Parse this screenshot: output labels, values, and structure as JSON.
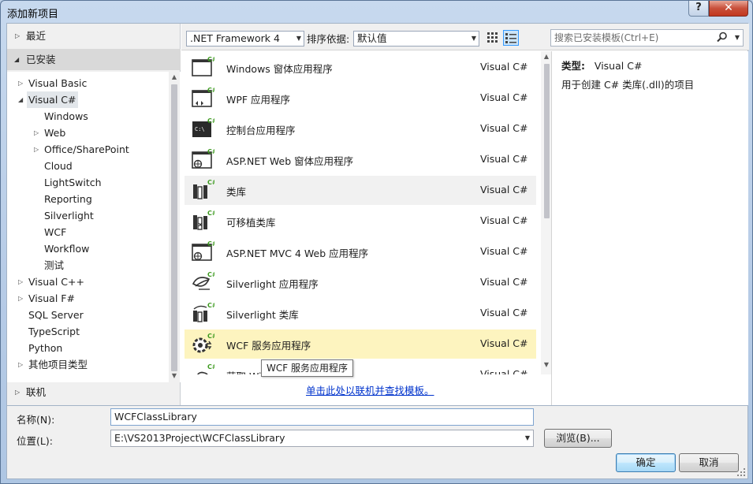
{
  "window": {
    "title": "添加新项目"
  },
  "titlebar": {
    "help_glyph": "?",
    "close_glyph": "✕"
  },
  "left_panel": {
    "recent": "最近",
    "installed": "已安装",
    "online": "联机",
    "tree": [
      {
        "label": "Visual Basic",
        "level": 0,
        "arrow": "collapsed"
      },
      {
        "label": "Visual C#",
        "level": 0,
        "arrow": "expanded",
        "selected": true
      },
      {
        "label": "Windows",
        "level": 1,
        "arrow": "none"
      },
      {
        "label": "Web",
        "level": 1,
        "arrow": "collapsed"
      },
      {
        "label": "Office/SharePoint",
        "level": 1,
        "arrow": "collapsed"
      },
      {
        "label": "Cloud",
        "level": 1,
        "arrow": "none"
      },
      {
        "label": "LightSwitch",
        "level": 1,
        "arrow": "none"
      },
      {
        "label": "Reporting",
        "level": 1,
        "arrow": "none"
      },
      {
        "label": "Silverlight",
        "level": 1,
        "arrow": "none"
      },
      {
        "label": "WCF",
        "level": 1,
        "arrow": "none"
      },
      {
        "label": "Workflow",
        "level": 1,
        "arrow": "none"
      },
      {
        "label": "测试",
        "level": 1,
        "arrow": "none"
      },
      {
        "label": "Visual C++",
        "level": 0,
        "arrow": "collapsed"
      },
      {
        "label": "Visual F#",
        "level": 0,
        "arrow": "collapsed"
      },
      {
        "label": "SQL Server",
        "level": 0,
        "arrow": "none"
      },
      {
        "label": "TypeScript",
        "level": 0,
        "arrow": "none"
      },
      {
        "label": "Python",
        "level": 0,
        "arrow": "none"
      },
      {
        "label": "其他项目类型",
        "level": 0,
        "arrow": "collapsed"
      }
    ]
  },
  "toolbar": {
    "framework": ".NET Framework 4",
    "sort_label": "排序依据:",
    "sort_value": "默认值",
    "search_placeholder": "搜索已安装模板(Ctrl+E)"
  },
  "templates": [
    {
      "name": "Windows 窗体应用程序",
      "lang": "Visual C#",
      "icon": "windows-forms-icon"
    },
    {
      "name": "WPF 应用程序",
      "lang": "Visual C#",
      "icon": "wpf-app-icon"
    },
    {
      "name": "控制台应用程序",
      "lang": "Visual C#",
      "icon": "console-app-icon"
    },
    {
      "name": "ASP.NET Web 窗体应用程序",
      "lang": "Visual C#",
      "icon": "aspnet-web-icon"
    },
    {
      "name": "类库",
      "lang": "Visual C#",
      "icon": "class-library-icon",
      "state": "hover"
    },
    {
      "name": "可移植类库",
      "lang": "Visual C#",
      "icon": "portable-library-icon"
    },
    {
      "name": "ASP.NET MVC 4 Web 应用程序",
      "lang": "Visual C#",
      "icon": "aspnet-mvc-icon"
    },
    {
      "name": "Silverlight 应用程序",
      "lang": "Visual C#",
      "icon": "silverlight-app-icon"
    },
    {
      "name": "Silverlight 类库",
      "lang": "Visual C#",
      "icon": "silverlight-library-icon"
    },
    {
      "name": "WCF 服务应用程序",
      "lang": "Visual C#",
      "icon": "wcf-service-icon",
      "state": "selected"
    },
    {
      "name": "获取 Wi...... .NET",
      "lang": "Visual C#",
      "icon": "cloud-icon"
    }
  ],
  "tooltip": "WCF 服务应用程序",
  "online_link": "单击此处以联机并查找模板。",
  "details": {
    "type_label": "类型:",
    "type_value": "Visual C#",
    "description": "用于创建 C# 类库(.dll)的项目"
  },
  "form": {
    "name_label": "名称(N):",
    "name_value": "WCFClassLibrary",
    "location_label": "位置(L):",
    "location_value": "E:\\VS2013Project\\WCFClassLibrary",
    "browse_label": "浏览(B)...",
    "ok_label": "确定",
    "cancel_label": "取消"
  },
  "colors": {
    "accent": "#3399ff",
    "selected_row": "#fdf4bf",
    "link": "#0033cc",
    "csharp_green": "#3c9a1e"
  }
}
